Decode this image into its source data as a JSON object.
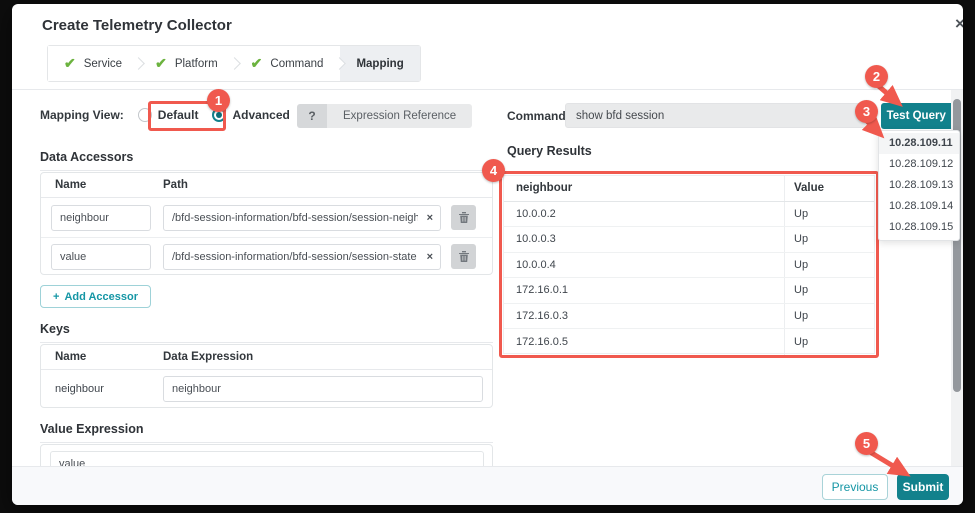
{
  "dialog": {
    "title": "Create Telemetry Collector",
    "close_icon": "×",
    "steps": [
      {
        "label": "Service"
      },
      {
        "label": "Platform"
      },
      {
        "label": "Command"
      },
      {
        "label": "Mapping"
      }
    ],
    "mapping_view": {
      "label": "Mapping View:",
      "options": [
        {
          "label": "Default",
          "selected": false
        },
        {
          "label": "Advanced",
          "selected": true
        }
      ]
    },
    "expression_reference": {
      "help": "?",
      "label": "Expression Reference"
    },
    "command": {
      "label": "Command:",
      "value": "show bfd session"
    },
    "test_query": {
      "label": "Test Query",
      "caret": "▾"
    },
    "device_menu": [
      "10.28.109.11",
      "10.28.109.12",
      "10.28.109.13",
      "10.28.109.14",
      "10.28.109.15"
    ],
    "data_accessors": {
      "heading": "Data Accessors",
      "columns": {
        "name": "Name",
        "path": "Path"
      },
      "rows": [
        {
          "name": "neighbour",
          "path": "/bfd-session-information/bfd-session/session-neighbor"
        },
        {
          "name": "value",
          "path": "/bfd-session-information/bfd-session/session-state"
        }
      ],
      "add_label": "Add Accessor"
    },
    "keys": {
      "heading": "Keys",
      "columns": {
        "name": "Name",
        "expression": "Data Expression"
      },
      "rows": [
        {
          "name": "neighbour",
          "expression": "neighbour"
        }
      ]
    },
    "value_expression": {
      "heading": "Value Expression",
      "value": "value"
    },
    "query_results": {
      "heading": "Query Results",
      "columns": {
        "neighbour": "neighbour",
        "value": "Value"
      },
      "rows": [
        {
          "n": "10.0.0.2",
          "v": "Up"
        },
        {
          "n": "10.0.0.3",
          "v": "Up"
        },
        {
          "n": "10.0.0.4",
          "v": "Up"
        },
        {
          "n": "172.16.0.1",
          "v": "Up"
        },
        {
          "n": "172.16.0.3",
          "v": "Up"
        },
        {
          "n": "172.16.0.5",
          "v": "Up"
        }
      ]
    },
    "footer": {
      "previous": "Previous",
      "submit": "Submit"
    },
    "callouts": [
      "1",
      "2",
      "3",
      "4",
      "5"
    ]
  },
  "icons": {
    "check": "✔",
    "clear": "×",
    "plus": "+"
  },
  "colors": {
    "accent_teal": "#12818c",
    "callout_red": "#f0594e",
    "check_green": "#6cb33f"
  }
}
